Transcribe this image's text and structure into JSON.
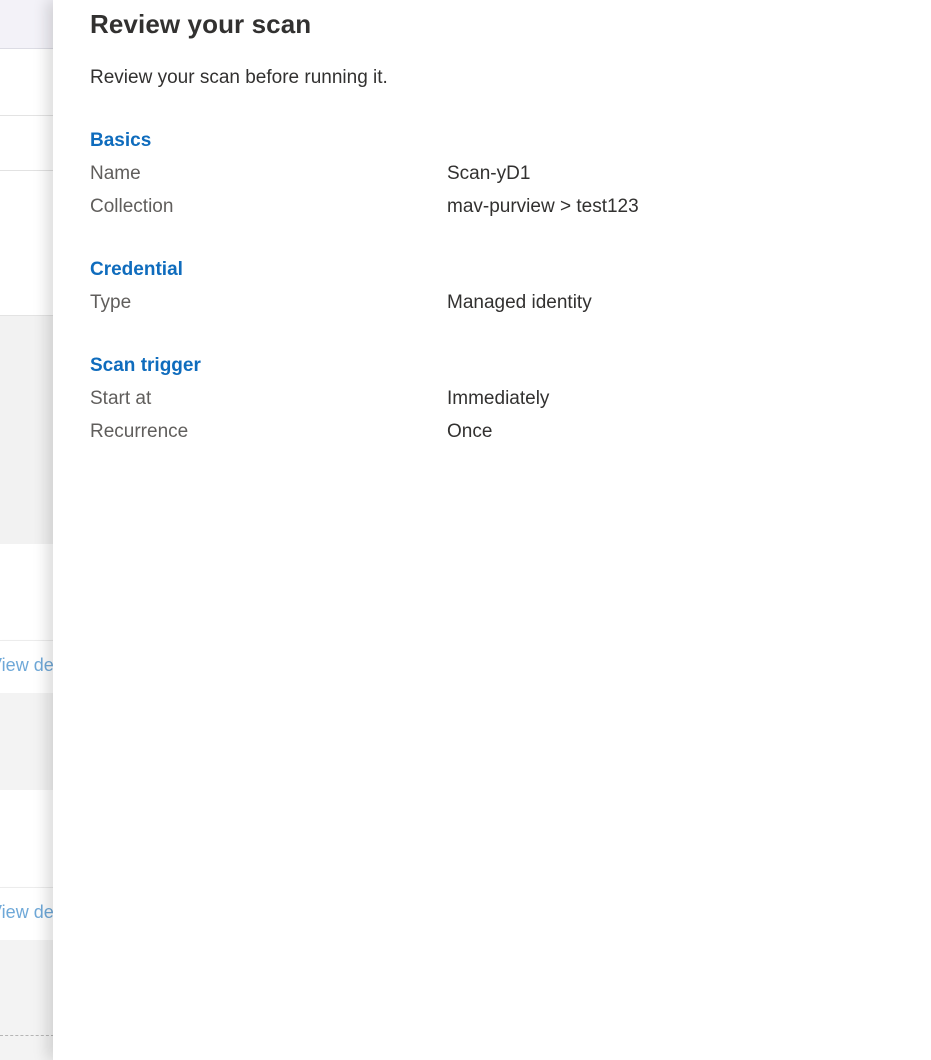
{
  "background": {
    "view_details_link": "View details"
  },
  "panel": {
    "title": "Review your scan",
    "subtitle": "Review your scan before running it.",
    "sections": {
      "basics": {
        "heading": "Basics",
        "name_label": "Name",
        "name_value": "Scan-yD1",
        "collection_label": "Collection",
        "collection_value": "mav-purview > test123"
      },
      "credential": {
        "heading": "Credential",
        "type_label": "Type",
        "type_value": "Managed identity"
      },
      "scan_trigger": {
        "heading": "Scan trigger",
        "start_label": "Start at",
        "start_value": "Immediately",
        "recurrence_label": "Recurrence",
        "recurrence_value": "Once"
      }
    }
  }
}
